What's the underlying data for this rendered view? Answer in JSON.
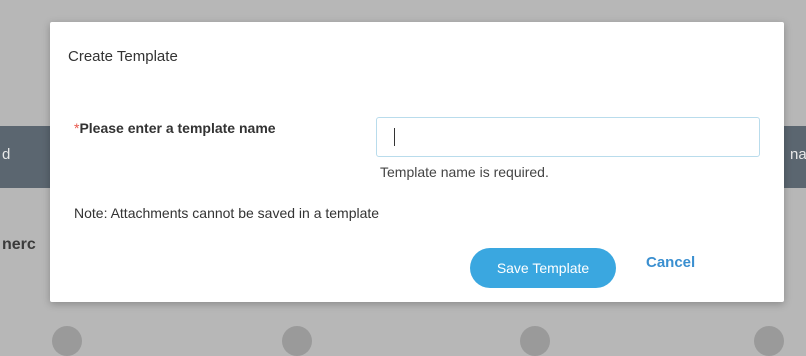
{
  "background": {
    "bar_left_text": "d",
    "bar_right_text": "na",
    "side_text": "nerc"
  },
  "dialog": {
    "title": "Create Template",
    "required_marker": "*",
    "field_label": "Please enter a template name",
    "input_value": "",
    "error_message": "Template name is required.",
    "note": "Note: Attachments cannot be saved in a template",
    "save_label": "Save Template",
    "cancel_label": "Cancel"
  },
  "colors": {
    "primary": "#3aa7e0",
    "link": "#3a8fd0",
    "required": "#e8584c",
    "overlay": "#b7b7b7"
  }
}
